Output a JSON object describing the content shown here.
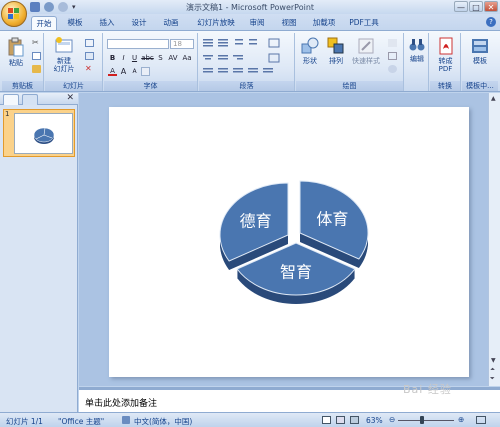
{
  "window": {
    "title": "演示文稿1 - Microsoft PowerPoint",
    "minimize": "—",
    "maximize": "□",
    "close": "✕"
  },
  "tabs": [
    "开始",
    "模板",
    "插入",
    "设计",
    "动画",
    "幻灯片放映",
    "审阅",
    "视图",
    "加载项",
    "PDF工具"
  ],
  "ribbon": {
    "clipboard": {
      "paste": "粘贴",
      "label": "剪贴板"
    },
    "slides": {
      "new_slide_line1": "新建",
      "new_slide_line2": "幻灯片",
      "label": "幻灯片"
    },
    "font": {
      "size": "18",
      "label": "字体",
      "bold": "B",
      "italic": "I",
      "underline": "U",
      "strike": "abc",
      "shadow": "S",
      "spacing": "AV",
      "case": "Aa",
      "color": "A",
      "grow": "A",
      "shrink": "A"
    },
    "paragraph": {
      "label": "段落"
    },
    "drawing": {
      "shapes": "形状",
      "arrange": "排列",
      "quick_styles": "快速样式",
      "label": "绘图"
    },
    "editing": {
      "label": "编辑"
    },
    "convert": {
      "pdf_line1": "转成",
      "pdf_line2": "PDF",
      "label": "转换"
    },
    "template": {
      "btn": "模板",
      "label": "模板中..."
    }
  },
  "slide_panel": {
    "slide_number": "1"
  },
  "chart_data": {
    "type": "pie",
    "categories": [
      "体育",
      "智育",
      "德育"
    ],
    "values": [
      33.3,
      33.3,
      33.3
    ],
    "color": "#4a76b0"
  },
  "notes_placeholder": "单击此处添加备注",
  "status": {
    "slide_info": "幻灯片 1/1",
    "theme": "\"Office 主题\"",
    "language": "中文(简体，中国)",
    "zoom": "63%"
  },
  "watermark": "Bai 经验"
}
